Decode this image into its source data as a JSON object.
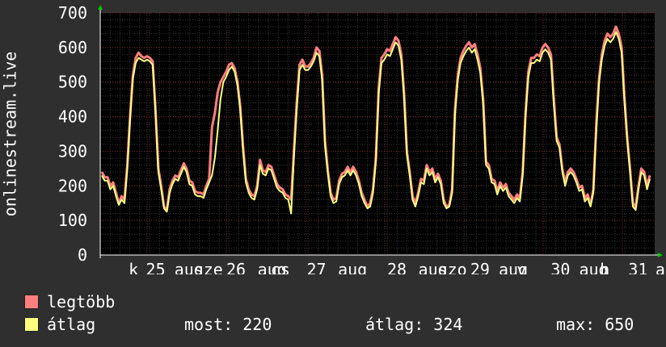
{
  "chart_data": {
    "type": "line",
    "ylabel": "onlinestream.live",
    "ylim": [
      0,
      700
    ],
    "yticks": [
      0,
      100,
      200,
      300,
      400,
      500,
      600,
      700
    ],
    "x_labels": [
      {
        "text": "k",
        "pos": 0.06
      },
      {
        "text": "25",
        "pos": 0.1
      },
      {
        "text": "aug",
        "pos": 0.16
      },
      {
        "text": "sze",
        "pos": 0.195
      },
      {
        "text": "26",
        "pos": 0.245
      },
      {
        "text": "aug",
        "pos": 0.31
      },
      {
        "text": "cs",
        "pos": 0.325
      },
      {
        "text": "27",
        "pos": 0.39
      },
      {
        "text": "aug",
        "pos": 0.455
      },
      {
        "text": "28",
        "pos": 0.535
      },
      {
        "text": "aug",
        "pos": 0.6
      },
      {
        "text": "szo",
        "pos": 0.635
      },
      {
        "text": "29",
        "pos": 0.685
      },
      {
        "text": "aug",
        "pos": 0.745
      },
      {
        "text": "v",
        "pos": 0.76
      },
      {
        "text": "30",
        "pos": 0.83
      },
      {
        "text": "aug",
        "pos": 0.89
      },
      {
        "text": "h",
        "pos": 0.91
      },
      {
        "text": "31",
        "pos": 0.97
      },
      {
        "text": "a",
        "pos": 1.01
      }
    ],
    "series": [
      {
        "name": "legtöbb",
        "color": "#ff7f7f",
        "values": [
          240,
          225,
          225,
          200,
          210,
          180,
          150,
          170,
          160,
          260,
          400,
          520,
          570,
          585,
          575,
          570,
          575,
          570,
          560,
          420,
          250,
          200,
          140,
          130,
          190,
          215,
          230,
          225,
          245,
          265,
          250,
          215,
          210,
          185,
          180,
          180,
          175,
          200,
          220,
          370,
          410,
          470,
          500,
          515,
          530,
          550,
          555,
          540,
          500,
          430,
          315,
          220,
          190,
          175,
          170,
          200,
          275,
          245,
          240,
          260,
          255,
          230,
          205,
          195,
          190,
          175,
          170,
          160,
          300,
          440,
          550,
          565,
          545,
          545,
          555,
          570,
          600,
          590,
          520,
          330,
          245,
          180,
          160,
          165,
          215,
          235,
          240,
          255,
          240,
          255,
          240,
          215,
          180,
          160,
          140,
          150,
          190,
          280,
          480,
          570,
          580,
          595,
          590,
          610,
          630,
          620,
          580,
          470,
          300,
          240,
          170,
          150,
          180,
          220,
          215,
          260,
          240,
          250,
          220,
          235,
          215,
          160,
          140,
          145,
          190,
          420,
          520,
          570,
          590,
          605,
          615,
          600,
          610,
          580,
          540,
          450,
          270,
          260,
          220,
          215,
          185,
          210,
          195,
          205,
          180,
          170,
          160,
          175,
          165,
          240,
          410,
          530,
          570,
          570,
          580,
          575,
          600,
          610,
          600,
          580,
          450,
          340,
          320,
          250,
          210,
          240,
          250,
          240,
          220,
          195,
          200,
          165,
          175,
          145,
          190,
          370,
          510,
          580,
          620,
          640,
          630,
          640,
          660,
          640,
          600,
          460,
          340,
          250,
          150,
          140,
          200,
          250,
          240,
          200,
          230
        ]
      },
      {
        "name": "átlag",
        "color": "#ffff80",
        "values": [
          230,
          215,
          215,
          190,
          200,
          170,
          145,
          160,
          150,
          250,
          390,
          510,
          555,
          570,
          565,
          560,
          565,
          560,
          550,
          410,
          240,
          190,
          135,
          125,
          180,
          205,
          220,
          215,
          235,
          255,
          240,
          205,
          200,
          175,
          170,
          170,
          165,
          190,
          210,
          230,
          280,
          360,
          450,
          500,
          515,
          535,
          545,
          530,
          490,
          420,
          300,
          210,
          180,
          165,
          160,
          190,
          260,
          235,
          230,
          250,
          245,
          220,
          195,
          185,
          180,
          165,
          160,
          120,
          280,
          420,
          535,
          550,
          535,
          535,
          545,
          560,
          585,
          575,
          505,
          315,
          235,
          170,
          150,
          155,
          205,
          225,
          230,
          245,
          230,
          245,
          230,
          205,
          170,
          150,
          135,
          140,
          180,
          270,
          465,
          555,
          565,
          580,
          575,
          595,
          615,
          605,
          565,
          455,
          290,
          230,
          160,
          140,
          170,
          210,
          205,
          250,
          230,
          240,
          210,
          225,
          205,
          150,
          135,
          140,
          180,
          405,
          505,
          555,
          575,
          590,
          600,
          585,
          595,
          565,
          525,
          435,
          260,
          250,
          210,
          205,
          175,
          200,
          185,
          195,
          170,
          160,
          150,
          165,
          155,
          230,
          400,
          515,
          555,
          555,
          565,
          560,
          585,
          595,
          585,
          565,
          435,
          330,
          310,
          240,
          200,
          230,
          240,
          230,
          210,
          185,
          190,
          155,
          165,
          140,
          180,
          355,
          495,
          565,
          605,
          625,
          615,
          625,
          645,
          625,
          585,
          445,
          330,
          240,
          140,
          130,
          190,
          240,
          230,
          190,
          220
        ]
      }
    ],
    "grid": true
  },
  "legend": {
    "items": [
      {
        "label": "legtöbb",
        "color": "#ff7f7f"
      },
      {
        "label": "átlag",
        "color": "#ffff80"
      }
    ],
    "stats": {
      "current": "most: 220",
      "average": "átlag: 324",
      "max": "max: 650"
    }
  },
  "colors": {
    "background": "#2f2f2f",
    "plot_background": "#000000",
    "grid_minor": "#3a3a3a",
    "grid_major": "#7a3030",
    "axis": "#ffffff",
    "arrow": "#00cc00"
  }
}
